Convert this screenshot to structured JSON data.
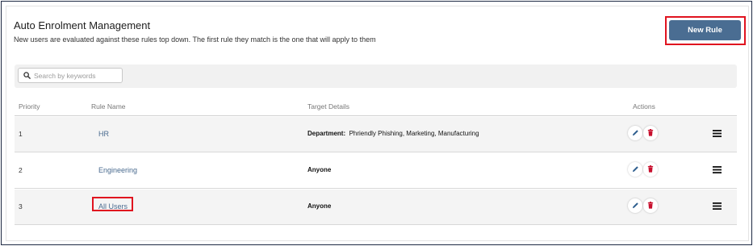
{
  "header": {
    "title": "Auto Enrolment Management",
    "subtitle": "New users are evaluated against these rules top down. The first rule they match is the one that will apply to them",
    "new_rule_label": "New Rule"
  },
  "search": {
    "placeholder": "Search by keywords",
    "value": ""
  },
  "table": {
    "columns": {
      "priority": "Priority",
      "rule_name": "Rule Name",
      "target_details": "Target Details",
      "actions": "Actions"
    },
    "rows": [
      {
        "priority": "1",
        "name": "HR",
        "target_label": "Department:",
        "target_value": "Phriendly Phishing, Marketing, Manufacturing"
      },
      {
        "priority": "2",
        "name": "Engineering",
        "target_label": "Anyone",
        "target_value": ""
      },
      {
        "priority": "3",
        "name": "All Users",
        "target_label": "Anyone",
        "target_value": ""
      }
    ]
  },
  "colors": {
    "primary_button": "#4a6d92",
    "highlight": "#e0131f",
    "edit_icon": "#2f5f8f",
    "delete_icon": "#c8102e",
    "link_text": "#4a6b8f"
  },
  "icons": {
    "search": "search-icon",
    "edit": "pencil-icon",
    "delete": "trash-icon",
    "drag": "hamburger-icon"
  }
}
